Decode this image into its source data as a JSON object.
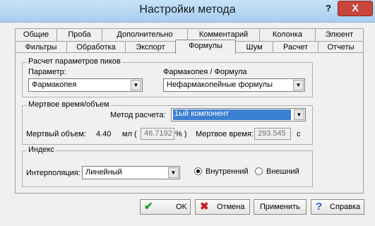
{
  "window": {
    "title": "Настройки метода",
    "help": "?",
    "close": "X"
  },
  "tabs_row1": [
    "Общие",
    "Проба",
    "Дополнительно",
    "Комментарий",
    "Колонка",
    "Элюент"
  ],
  "tabs_row2": [
    "Фильтры",
    "Обработка",
    "Экспорт",
    "Формулы",
    "Шум",
    "Расчет",
    "Отчеты"
  ],
  "active_tab": "Формулы",
  "peaks": {
    "title": "Расчет параметров пиков",
    "param_label": "Параметр:",
    "param_value": "Фармакопея",
    "formula_label": "Фармакопея / Формула",
    "formula_value": "Нефармакопейные  формулы"
  },
  "dead_time": {
    "title": "Мертвое время/объем",
    "method_label": "Метод расчета:",
    "method_value": "1ый компонент",
    "volume_label": "Мертвый объем:",
    "volume_value": "4.40",
    "volume_unit": "мл (",
    "percent_value": "46.7192",
    "percent_unit": "% )",
    "time_label": "Мертвое время:",
    "time_value": "293.545",
    "time_unit": "с"
  },
  "index": {
    "title": "Индекс",
    "interp_label": "Интерполяция:",
    "interp_value": "Линейный",
    "internal_label": "Внутренний",
    "external_label": "Внешний",
    "selected": "internal"
  },
  "buttons": {
    "ok": "OK",
    "cancel": "Отмена",
    "apply": "Применить",
    "help": "Справка"
  },
  "colors": {
    "selection": "#3b7fd1",
    "ok_icon": "#1a9e1a",
    "cancel_icon": "#c81e1e",
    "help_icon": "#2a5cc8"
  }
}
